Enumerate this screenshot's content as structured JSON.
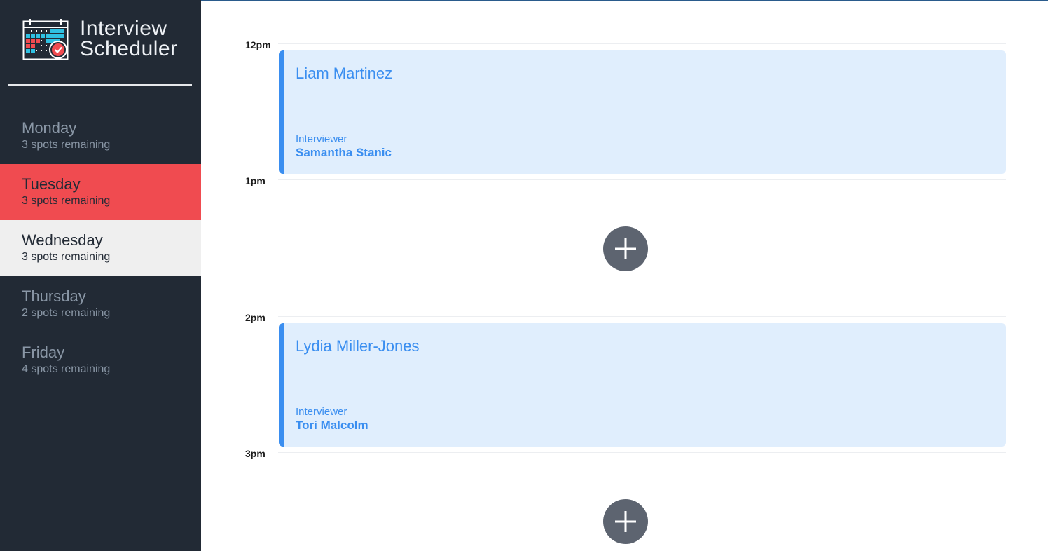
{
  "brand": {
    "line1": "Interview",
    "line2": "Scheduler",
    "logo_icon": "calendar-check-icon"
  },
  "days": [
    {
      "name": "Monday",
      "spots": "3 spots remaining",
      "state": "normal"
    },
    {
      "name": "Tuesday",
      "spots": "3 spots remaining",
      "state": "selected"
    },
    {
      "name": "Wednesday",
      "spots": "3 spots remaining",
      "state": "hover"
    },
    {
      "name": "Thursday",
      "spots": "2 spots remaining",
      "state": "normal"
    },
    {
      "name": "Friday",
      "spots": "4 spots remaining",
      "state": "normal"
    }
  ],
  "schedule": {
    "hours": [
      "12pm",
      "1pm",
      "2pm",
      "3pm"
    ],
    "appointments": [
      {
        "student": "Liam Martinez",
        "interviewer_label": "Interviewer",
        "interviewer": "Samantha Stanic"
      },
      {
        "student": "Lydia Miller-Jones",
        "interviewer_label": "Interviewer",
        "interviewer": "Tori Malcolm"
      }
    ],
    "add_icon": "plus-icon"
  },
  "colors": {
    "sidebar_bg": "#222a35",
    "selected_day": "#f04b50",
    "hover_day": "#efefef",
    "appointment_bg": "#e0eefd",
    "appointment_accent": "#3a8ef0",
    "add_button": "#5d6470"
  }
}
